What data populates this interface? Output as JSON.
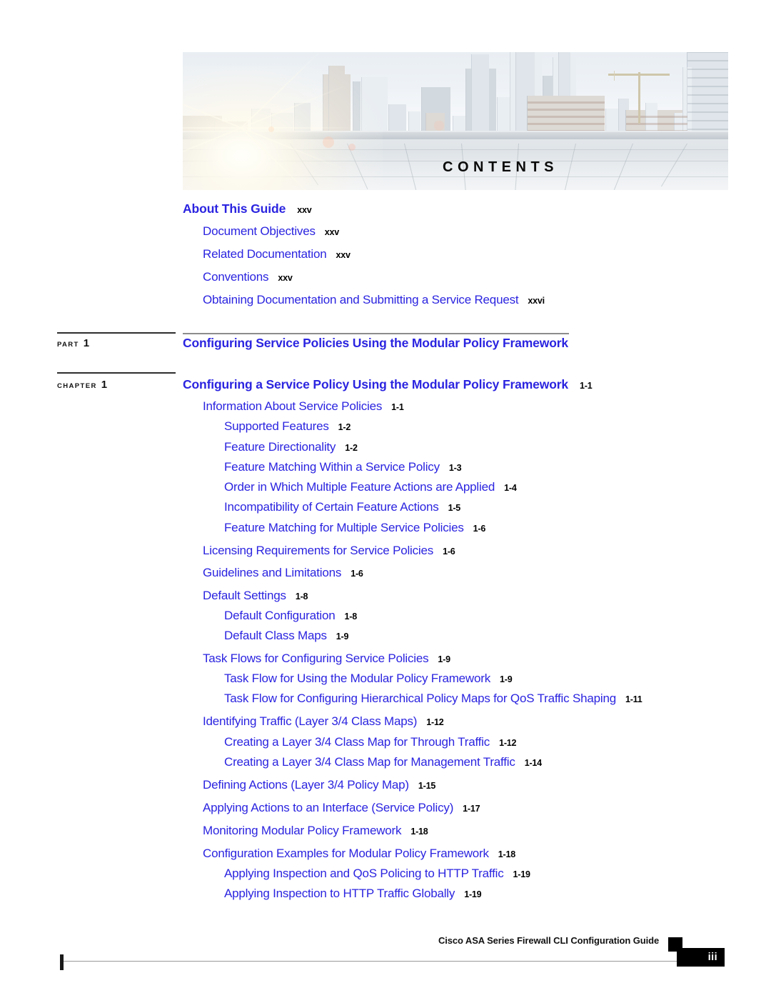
{
  "banner": {
    "title": "CONTENTS",
    "image_alt": "city-skyline-rooftop-photo"
  },
  "toc": {
    "front_matter": {
      "heading": {
        "title": "About This Guide",
        "page": "xxv"
      },
      "items": [
        {
          "title": "Document Objectives",
          "page": "xxv",
          "level": 1
        },
        {
          "title": "Related Documentation",
          "page": "xxv",
          "level": 1
        },
        {
          "title": "Conventions",
          "page": "xxv",
          "level": 1
        },
        {
          "title": "Obtaining Documentation and Submitting a Service Request",
          "page": "xxvi",
          "level": 1
        }
      ]
    },
    "part": {
      "label": "PART",
      "number": "1",
      "title": "Configuring Service Policies Using the Modular Policy Framework"
    },
    "chapter": {
      "label": "CHAPTER",
      "number": "1",
      "title": "Configuring a Service Policy Using the Modular Policy Framework",
      "page": "1-1"
    },
    "entries": [
      {
        "title": "Information About Service Policies",
        "page": "1-1",
        "level": 1
      },
      {
        "title": "Supported Features",
        "page": "1-2",
        "level": 2
      },
      {
        "title": "Feature Directionality",
        "page": "1-2",
        "level": 2
      },
      {
        "title": "Feature Matching Within a Service Policy",
        "page": "1-3",
        "level": 2
      },
      {
        "title": "Order in Which Multiple Feature Actions are Applied",
        "page": "1-4",
        "level": 2
      },
      {
        "title": "Incompatibility of Certain Feature Actions",
        "page": "1-5",
        "level": 2
      },
      {
        "title": "Feature Matching for Multiple Service Policies",
        "page": "1-6",
        "level": 2
      },
      {
        "title": "Licensing Requirements for Service Policies",
        "page": "1-6",
        "level": 1
      },
      {
        "title": "Guidelines and Limitations",
        "page": "1-6",
        "level": 1
      },
      {
        "title": "Default Settings",
        "page": "1-8",
        "level": 1
      },
      {
        "title": "Default Configuration",
        "page": "1-8",
        "level": 2
      },
      {
        "title": "Default Class Maps",
        "page": "1-9",
        "level": 2
      },
      {
        "title": "Task Flows for Configuring Service Policies",
        "page": "1-9",
        "level": 1
      },
      {
        "title": "Task Flow for Using the Modular Policy Framework",
        "page": "1-9",
        "level": 2
      },
      {
        "title": "Task Flow for Configuring Hierarchical Policy Maps for QoS Traffic Shaping",
        "page": "1-11",
        "level": 2
      },
      {
        "title": "Identifying Traffic (Layer 3/4 Class Maps)",
        "page": "1-12",
        "level": 1
      },
      {
        "title": "Creating a Layer 3/4 Class Map for Through Traffic",
        "page": "1-12",
        "level": 2
      },
      {
        "title": "Creating a Layer 3/4 Class Map for Management Traffic",
        "page": "1-14",
        "level": 2
      },
      {
        "title": "Defining Actions (Layer 3/4 Policy Map)",
        "page": "1-15",
        "level": 1
      },
      {
        "title": "Applying Actions to an Interface (Service Policy)",
        "page": "1-17",
        "level": 1
      },
      {
        "title": "Monitoring Modular Policy Framework",
        "page": "1-18",
        "level": 1
      },
      {
        "title": "Configuration Examples for Modular Policy Framework",
        "page": "1-18",
        "level": 1
      },
      {
        "title": "Applying Inspection and QoS Policing to HTTP Traffic",
        "page": "1-19",
        "level": 2
      },
      {
        "title": "Applying Inspection to HTTP Traffic Globally",
        "page": "1-19",
        "level": 2
      }
    ]
  },
  "footer": {
    "guide_title": "Cisco ASA Series Firewall CLI Configuration Guide",
    "page_number": "iii"
  },
  "colors": {
    "link_blue": "#2b24e0",
    "page_number_black": "#000000",
    "part_rule": "#2e2e2e",
    "title_rule": "#8c8c8c"
  }
}
